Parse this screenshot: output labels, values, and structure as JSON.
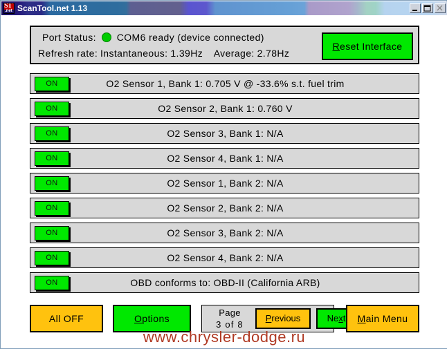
{
  "window": {
    "title": "ScanTool.net 1.13",
    "icon_primary_text": "ST",
    "icon_secondary_text": ".net",
    "controls": {
      "minimize_label": "minimize",
      "maximize_label": "maximize",
      "close_label": "close"
    }
  },
  "status_panel": {
    "port_status_label": "Port Status:",
    "port_status_value": "COM6 ready (device connected)",
    "led_color": "#00cc00",
    "refresh_rate_label": "Refresh rate:",
    "instantaneous_label": "Instantaneous:",
    "instantaneous_value": "1.39Hz",
    "average_label": "Average:",
    "average_value": "2.78Hz",
    "reset_button": {
      "accel_letter": "R",
      "rest_label": "eset Interface"
    }
  },
  "rows": [
    {
      "toggle_label": "ON",
      "label": "O2 Sensor 1, Bank 1: 0.705 V @ -33.6% s.t. fuel trim"
    },
    {
      "toggle_label": "ON",
      "label": "O2 Sensor 2, Bank 1: 0.760 V"
    },
    {
      "toggle_label": "ON",
      "label": "O2 Sensor 3, Bank 1: N/A"
    },
    {
      "toggle_label": "ON",
      "label": "O2 Sensor 4, Bank 1: N/A"
    },
    {
      "toggle_label": "ON",
      "label": "O2 Sensor 1, Bank 2: N/A"
    },
    {
      "toggle_label": "ON",
      "label": "O2 Sensor 2, Bank 2: N/A"
    },
    {
      "toggle_label": "ON",
      "label": "O2 Sensor 3, Bank 2: N/A"
    },
    {
      "toggle_label": "ON",
      "label": "O2 Sensor 4, Bank 2: N/A"
    },
    {
      "toggle_label": "ON",
      "label": "OBD conforms to: OBD-II (California ARB)"
    }
  ],
  "bottom_bar": {
    "all_off_label": "All OFF",
    "options": {
      "accel_letter": "O",
      "rest_label": "ptions"
    },
    "page": {
      "line1": "Page",
      "line2": "3 of 8",
      "current": "3",
      "total": "8"
    },
    "previous": {
      "accel_letter": "P",
      "rest_label": "revious"
    },
    "next": {
      "prefix_label": "Ne",
      "accel_letter": "x",
      "rest_label": "t"
    },
    "main_menu": {
      "accel_letter": "M",
      "rest_label": "ain Menu"
    }
  },
  "watermark": {
    "text": "www.chrysler-dodge.ru",
    "color": "#b03a24"
  }
}
